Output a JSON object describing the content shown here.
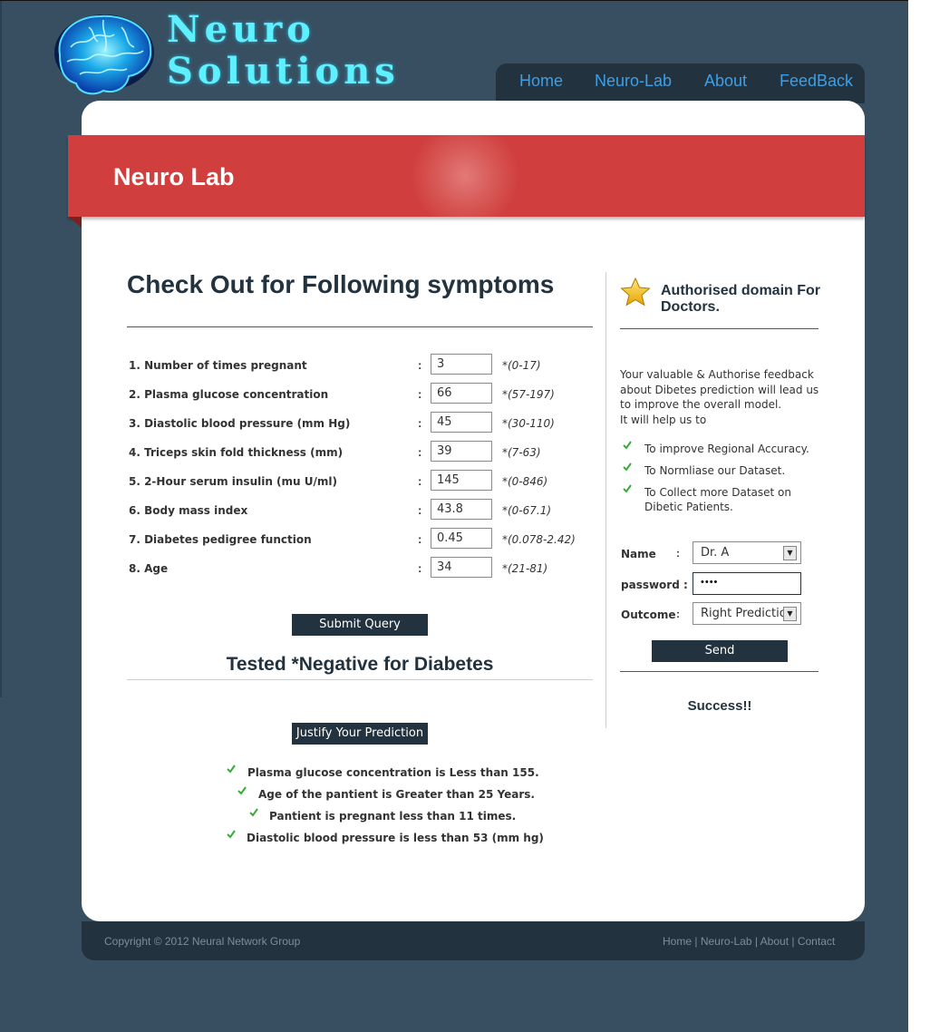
{
  "brand": {
    "line1": "Neuro",
    "line2": "Solutions"
  },
  "nav": [
    "Home",
    "Neuro-Lab",
    "About",
    "FeedBack"
  ],
  "banner": {
    "title": "Neuro Lab"
  },
  "main": {
    "title": "Check Out for Following symptoms",
    "fields": [
      {
        "label": "1. Number of times pregnant",
        "value": "3",
        "range": "*(0-17)"
      },
      {
        "label": "2. Plasma glucose concentration",
        "value": "66",
        "range": "*(57-197)"
      },
      {
        "label": "3. Diastolic blood pressure (mm Hg)",
        "value": "45",
        "range": "*(30-110)"
      },
      {
        "label": "4. Triceps skin fold thickness (mm)",
        "value": "39",
        "range": "*(7-63)"
      },
      {
        "label": "5. 2-Hour serum insulin (mu U/ml)",
        "value": "145",
        "range": "*(0-846)"
      },
      {
        "label": "6. Body mass index",
        "value": "43.8",
        "range": "*(0-67.1)"
      },
      {
        "label": "7. Diabetes pedigree function",
        "value": "0.45",
        "range": "*(0.078-2.42)"
      },
      {
        "label": "8. Age",
        "value": "34",
        "range": "*(21-81)"
      }
    ],
    "colon": ":",
    "submit_label": "Submit Query",
    "result": "Tested *Negative for Diabetes",
    "justify_label": "Justify Your Prediction",
    "reasons": [
      "Plasma glucose concentration is Less than 155.",
      "Age of the pantient is Greater than 25 Years.",
      "Pantient is pregnant less than 11 times.",
      "Diastolic blood pressure is less than 53 (mm hg)"
    ]
  },
  "sidebar": {
    "title": "Authorised domain For Doctors.",
    "paragraph": "Your valuable & Authorise feedback about Dibetes prediction will lead us to improve the overall model.",
    "paragraph2": "It will help us to",
    "items": [
      "To improve Regional Accuracy.",
      "To Normliase our Dataset.",
      "To Collect more Dataset on Dibetic Patients."
    ],
    "form": {
      "name_label": "Name",
      "name_value": "Dr. A",
      "password_label": "password :",
      "password_value": "••••",
      "outcome_label": "Outcome",
      "outcome_value": "Right Prediction",
      "colon": ":",
      "send_label": "Send"
    },
    "success": "Success!!"
  },
  "footer": {
    "copyright": "Copyright © 2012 Neural Network Group",
    "links": [
      "Home",
      "Neuro-Lab",
      "About",
      "Contact"
    ],
    "sep": "|"
  },
  "colors": {
    "background": "#374f61",
    "dark": "#23323f",
    "banner": "#d03e3e",
    "logo": "#5ef0ff",
    "nav_link": "#3d9fe6",
    "check": "#3aa83a"
  },
  "icons": {
    "logo": "brain-icon",
    "sidebar": "star-icon",
    "bullet": "check-icon",
    "select": "chevron-down-icon"
  }
}
